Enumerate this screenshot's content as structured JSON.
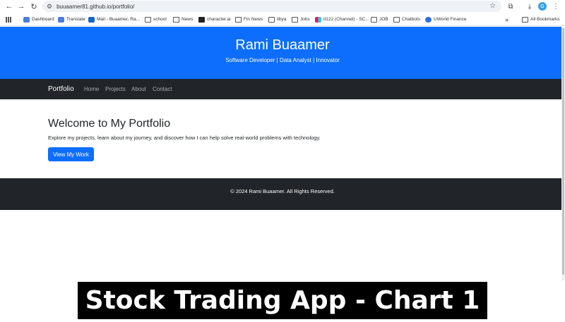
{
  "browser": {
    "url": "buuaamer81.github.io/portfolio/",
    "bookmarks": [
      {
        "label": "Dashboard"
      },
      {
        "label": "Translate"
      },
      {
        "label": "Mail - Buaamer, Ra..."
      },
      {
        "label": "school"
      },
      {
        "label": "News"
      },
      {
        "label": "character.ai"
      },
      {
        "label": "Fin News"
      },
      {
        "label": "libya"
      },
      {
        "label": "Jobs"
      },
      {
        "label": "it122 (Channel) - SC..."
      },
      {
        "label": "JOB"
      },
      {
        "label": "Chatbots"
      },
      {
        "label": "UWorld Finance"
      }
    ],
    "overflow_label": "»",
    "all_bookmarks": "All Bookmarks"
  },
  "hero": {
    "name": "Rami Buaamer",
    "tagline": "Software Developer | Data Analyst | Innovator"
  },
  "navbar": {
    "brand": "Portfolio",
    "links": [
      "Home",
      "Projects",
      "About",
      "Contact"
    ]
  },
  "main": {
    "heading": "Welcome to My Portfolio",
    "intro": "Explore my projects, learn about my journey, and discover how I can help solve real-world problems with technology.",
    "button": "View My Work"
  },
  "footer": {
    "copyright": "© 2024 Rami Buaamer. All Rights Reserved."
  },
  "caption": "Stock Trading App - Chart 1",
  "colors": {
    "primary": "#0d6efd",
    "dark": "#212529"
  }
}
